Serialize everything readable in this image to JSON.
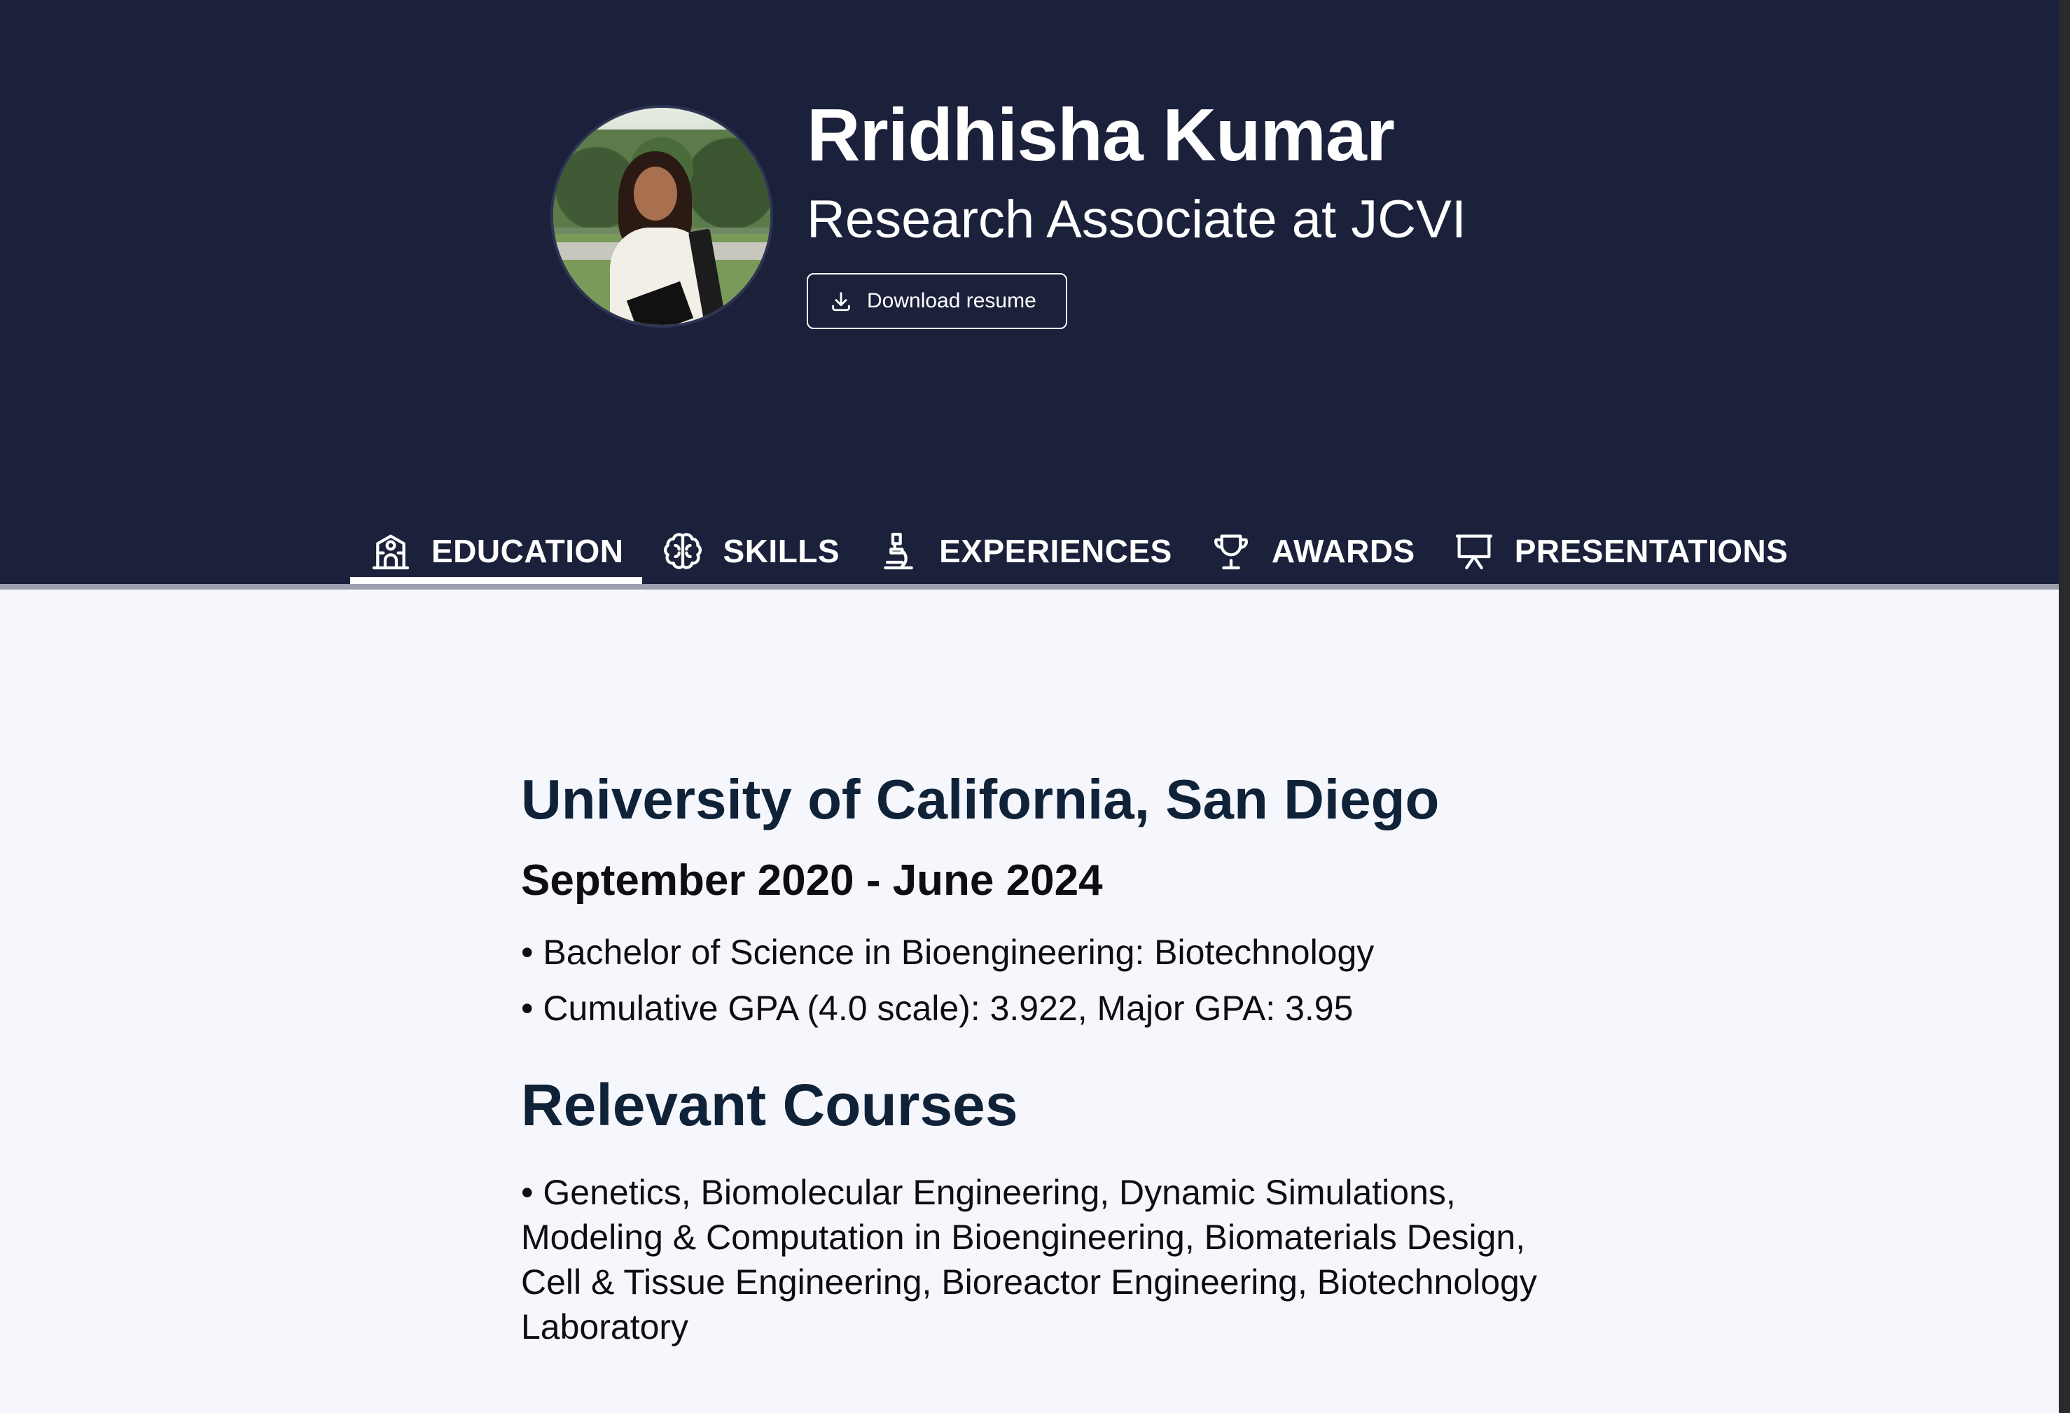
{
  "header": {
    "name": "Rridhisha Kumar",
    "role": "Research Associate at JCVI",
    "download_label": "Download resume"
  },
  "tabs": [
    {
      "label": "EDUCATION",
      "icon": "school-icon",
      "active": true
    },
    {
      "label": "SKILLS",
      "icon": "brain-icon",
      "active": false
    },
    {
      "label": "EXPERIENCES",
      "icon": "microscope-icon",
      "active": false
    },
    {
      "label": "AWARDS",
      "icon": "trophy-icon",
      "active": false
    },
    {
      "label": "PRESENTATIONS",
      "icon": "presentation-icon",
      "active": false
    }
  ],
  "education": {
    "school": "University of California, San Diego",
    "dates": "September 2020 - June 2024",
    "bullets": [
      "• Bachelor of Science in Bioengineering: Biotechnology",
      "• Cumulative GPA (4.0 scale): 3.922, Major GPA: 3.95"
    ],
    "courses_title": "Relevant Courses",
    "courses_text": "• Genetics, Biomolecular Engineering, Dynamic Simulations, Modeling & Computation in Bioengineering, Biomaterials Design, Cell & Tissue Engineering, Bioreactor Engineering, Biotechnology Laboratory"
  },
  "colors": {
    "header_bg": "#1b213a",
    "content_bg": "#f5f7fc",
    "heading": "#0f2238"
  }
}
